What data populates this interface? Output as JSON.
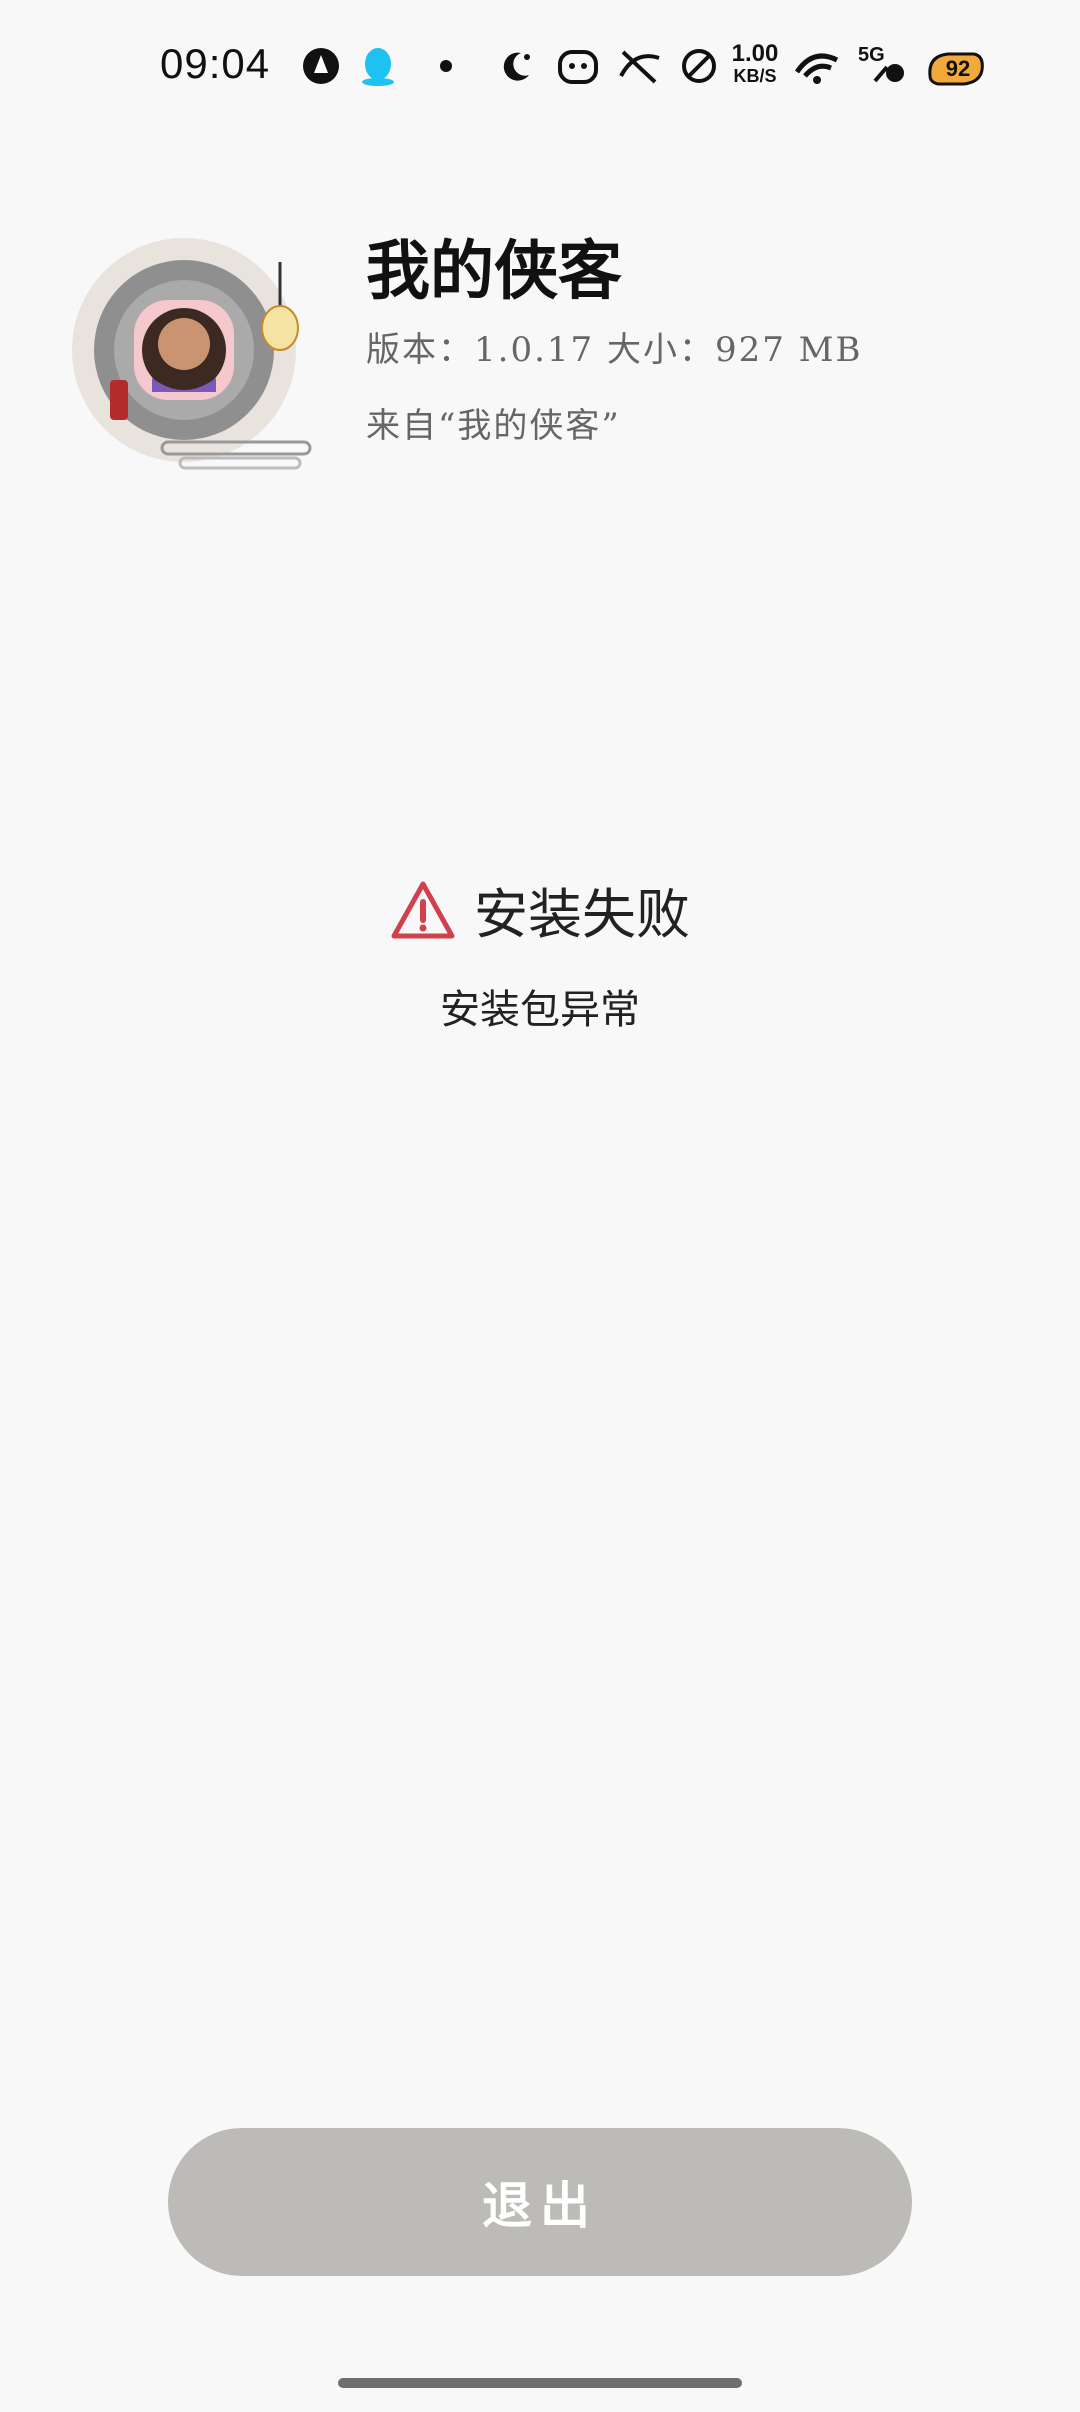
{
  "status_bar": {
    "time": "09:04",
    "network_speed_value": "1.00",
    "network_speed_unit": "KB/S",
    "signal_label": "5G",
    "battery_level": "92",
    "icons": [
      "app-circle-icon",
      "qq-penguin-icon",
      "dot-icon",
      "moon-star-icon",
      "tiger-face-icon",
      "mute-icon",
      "no-sim-icon",
      "wifi-icon",
      "signal-icon",
      "battery-icon"
    ]
  },
  "app": {
    "name": "我的侠客",
    "meta": "版本：1.0.17  大小：927 MB",
    "source": "来自“我的侠客”"
  },
  "result": {
    "title": "安装失败",
    "subtitle": "安装包异常",
    "warning_color": "#d0414e"
  },
  "actions": {
    "exit_label": "退出"
  }
}
